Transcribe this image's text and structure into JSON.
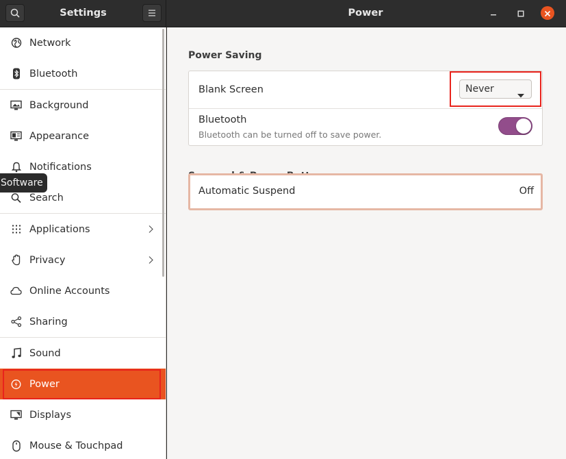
{
  "sidebar_header": {
    "title": "Settings",
    "search_icon": "search-icon",
    "menu_icon": "hamburger-menu-icon"
  },
  "panel_header": {
    "title": "Power",
    "minimize_icon": "minimize-icon",
    "maximize_icon": "maximize-icon",
    "close_icon": "close-icon"
  },
  "sidebar": {
    "items": [
      {
        "label": "Network",
        "icon": "network-icon"
      },
      {
        "label": "Bluetooth",
        "icon": "bluetooth-icon"
      },
      {
        "label": "Background",
        "icon": "background-icon"
      },
      {
        "label": "Appearance",
        "icon": "appearance-icon"
      },
      {
        "label": "Notifications",
        "icon": "bell-icon"
      },
      {
        "label": "Search",
        "icon": "search-icon"
      },
      {
        "label": "Applications",
        "icon": "grid-icon",
        "chevron": true
      },
      {
        "label": "Privacy",
        "icon": "hand-icon",
        "chevron": true
      },
      {
        "label": "Online Accounts",
        "icon": "cloud-icon"
      },
      {
        "label": "Sharing",
        "icon": "share-icon"
      },
      {
        "label": "Sound",
        "icon": "music-note-icon"
      },
      {
        "label": "Power",
        "icon": "power-icon",
        "active": true
      },
      {
        "label": "Displays",
        "icon": "display-icon"
      },
      {
        "label": "Mouse & Touchpad",
        "icon": "mouse-icon"
      }
    ],
    "tooltip": "Software"
  },
  "main": {
    "power_saving": {
      "title": "Power Saving",
      "blank_screen": {
        "label": "Blank Screen",
        "value": "Never"
      },
      "bluetooth": {
        "label": "Bluetooth",
        "subtitle": "Bluetooth can be turned off to save power.",
        "enabled": true
      }
    },
    "suspend": {
      "title": "Suspend & Power Button",
      "automatic_suspend": {
        "label": "Automatic Suspend",
        "value": "Off"
      }
    }
  },
  "colors": {
    "accent": "#e95420",
    "switch_on": "#924d8b",
    "highlight_outline": "#e8231c"
  }
}
